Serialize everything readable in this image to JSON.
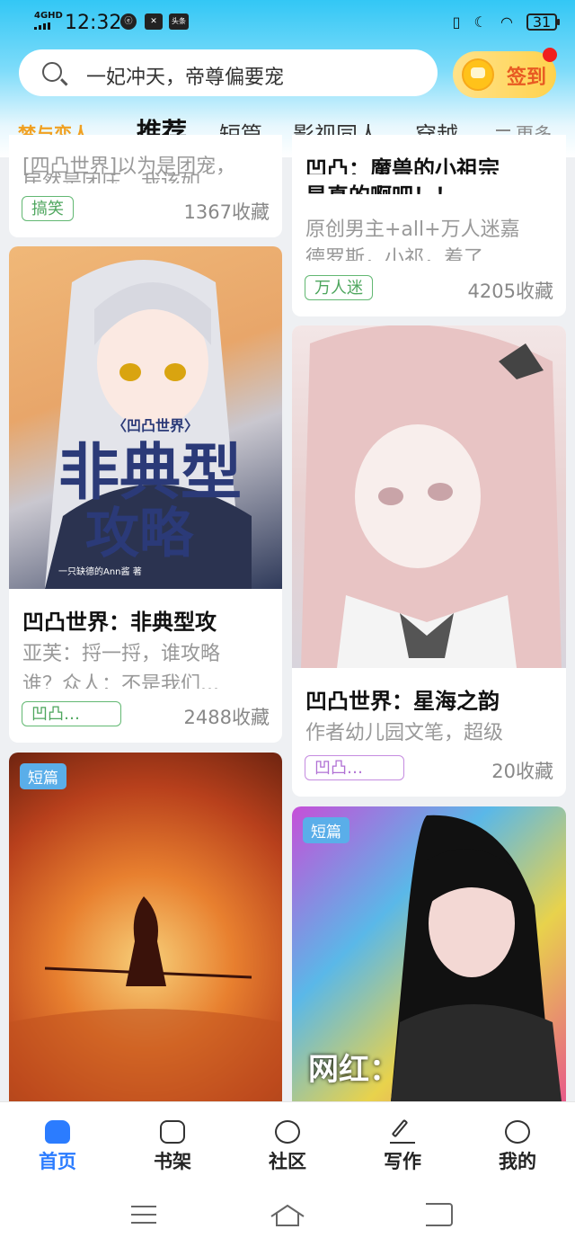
{
  "status_bar": {
    "network": "4GHD",
    "time": "12:32",
    "app_icons": [
      "ⓔ",
      "✕",
      "头条"
    ],
    "battery": "31"
  },
  "search": {
    "placeholder": "一妃冲天，帝尊偏要宠"
  },
  "checkin": {
    "label": "签到"
  },
  "tabs": [
    {
      "label": "梦与恋人"
    },
    {
      "label": "推荐"
    },
    {
      "label": "短篇"
    },
    {
      "label": "影视同人"
    },
    {
      "label": "穿越"
    }
  ],
  "more_label": "更多",
  "cards": {
    "left_top": {
      "desc": [
        "[四凸世界]以为是团宠，",
        "居然是团压，我该如..."
      ],
      "tag": "搞笑",
      "favorites": "1367收藏"
    },
    "right_top": {
      "title": [
        "凹凸：魔兽的小祖宗",
        "是真的啊吧！！"
      ],
      "desc": [
        "原创男主+all+万人迷嘉",
        "德罗斯，小祁，着了..."
      ],
      "tag": "万人迷",
      "favorites": "4205收藏"
    },
    "left_mid": {
      "cover_text": [
        "〈凹凸世界〉",
        "非典型",
        "攻略",
        "一只缺德的Ann酱 著"
      ],
      "title": "凹凸世界：非典型攻",
      "desc": [
        "亚芙：捋一捋，谁攻略",
        "谁？众人：不是我们..."
      ],
      "tag": "凹凸…",
      "favorites": "2488收藏"
    },
    "right_mid": {
      "title": "凹凸世界：星海之韵",
      "desc": "作者幼儿园文笔，超级",
      "tag": "凹凸…",
      "favorites": "20收藏"
    },
    "left_bottom": {
      "badge": "短篇"
    },
    "right_bottom": {
      "badge": "短篇",
      "overlay": "网红："
    }
  },
  "bottom_nav": [
    {
      "label": "首页"
    },
    {
      "label": "书架"
    },
    {
      "label": "社区"
    },
    {
      "label": "写作"
    },
    {
      "label": "我的"
    }
  ],
  "colors": {
    "accent_blue": "#2b7cff",
    "checkin_text": "#e85a22",
    "special_tab": "#f0a020",
    "tag_green": "#4ea65e",
    "tag_purple": "#b070d4"
  }
}
